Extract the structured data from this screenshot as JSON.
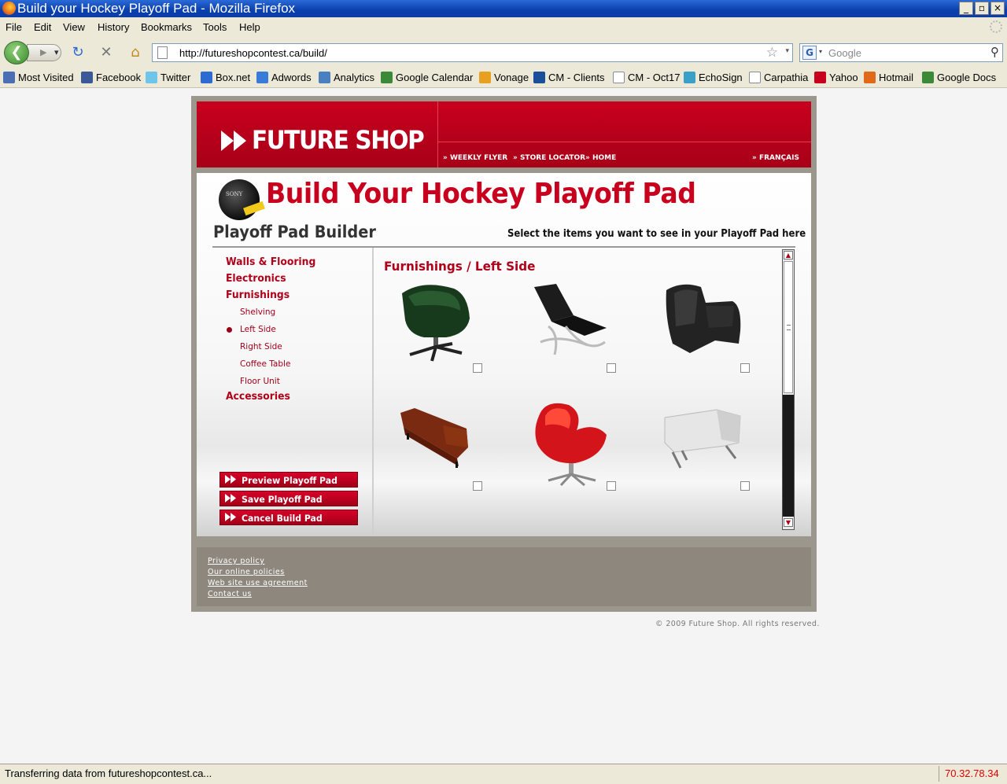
{
  "window": {
    "title": "Build your Hockey Playoff Pad - Mozilla Firefox",
    "controls": {
      "minimize": "_",
      "maximize": "▫",
      "close": "×"
    }
  },
  "menu": [
    "File",
    "Edit",
    "View",
    "History",
    "Bookmarks",
    "Tools",
    "Help"
  ],
  "navigation": {
    "url": "http://futureshopcontest.ca/build/",
    "search_placeholder": "Google",
    "search_engine_icon": "google-icon"
  },
  "bookmarks": [
    {
      "label": "Most Visited",
      "icon": "most-visited-icon",
      "color": "#4a6fb5"
    },
    {
      "label": "Facebook",
      "icon": "facebook-icon",
      "color": "#3b5998"
    },
    {
      "label": "Twitter",
      "icon": "twitter-icon",
      "color": "#6fc4ea"
    },
    {
      "label": "Box.net",
      "icon": "box-icon",
      "color": "#2d6bd2"
    },
    {
      "label": "Adwords",
      "icon": "google-icon",
      "color": "#3a7ad8"
    },
    {
      "label": "Analytics",
      "icon": "analytics-icon",
      "color": "#4a7fc0"
    },
    {
      "label": "Google Calendar",
      "icon": "google-icon",
      "color": "#3a8a3a"
    },
    {
      "label": "Vonage",
      "icon": "vonage-icon",
      "color": "#e8a020"
    },
    {
      "label": "CM - Clients",
      "icon": "cm-icon",
      "color": "#1a4f9a"
    },
    {
      "label": "CM - Oct17",
      "icon": "page-icon",
      "color": "#ffffff"
    },
    {
      "label": "EchoSign",
      "icon": "echosign-icon",
      "color": "#3aa0c8"
    },
    {
      "label": "Carpathia",
      "icon": "page-icon",
      "color": "#ffffff"
    },
    {
      "label": "Yahoo",
      "icon": "yahoo-icon",
      "color": "#c8001e"
    },
    {
      "label": "Hotmail",
      "icon": "windows-icon",
      "color": "#e06a1a"
    },
    {
      "label": "Google Docs",
      "icon": "google-icon",
      "color": "#3a8a3a"
    }
  ],
  "site": {
    "logo": "FUTURE SHOP",
    "header_nav": [
      "WEEKLY FLYER",
      "STORE LOCATOR",
      "HOME"
    ],
    "language_link": "FRANÇAIS",
    "puck_brand": "SONY",
    "page_title": "Build Your Hockey Playoff Pad",
    "builder_title": "Playoff Pad Builder",
    "builder_hint": "Select the items you want to see in your Playoff Pad here",
    "categories": [
      {
        "label": "Walls & Flooring"
      },
      {
        "label": "Electronics"
      },
      {
        "label": "Furnishings"
      }
    ],
    "subcategories": [
      {
        "label": "Shelving",
        "selected": false
      },
      {
        "label": "Left Side",
        "selected": true
      },
      {
        "label": "Right Side",
        "selected": false
      },
      {
        "label": "Coffee Table",
        "selected": false
      },
      {
        "label": "Floor Unit",
        "selected": false
      }
    ],
    "last_category": "Accessories",
    "panel_title": "Furnishings / Left Side",
    "items": [
      {
        "name": "dark-green-swivel-chair",
        "checked": false
      },
      {
        "name": "black-barcelona-chair",
        "checked": false
      },
      {
        "name": "black-leather-club-chair",
        "checked": false
      },
      {
        "name": "brown-leather-sofa",
        "checked": false
      },
      {
        "name": "red-egg-chair",
        "checked": false
      },
      {
        "name": "white-modern-armchair",
        "checked": false
      }
    ],
    "actions": [
      "Preview Playoff Pad",
      "Save Playoff Pad",
      "Cancel Build Pad"
    ],
    "footer_links": [
      "Privacy policy",
      "Our online policies",
      "Web site use agreement",
      "Contact us"
    ],
    "copyright": "© 2009 Future Shop. All rights reserved."
  },
  "status": {
    "message": "Transferring data from futureshopcontest.ca...",
    "ip": "70.32.78.34"
  },
  "colors": {
    "brand_red": "#c8001e",
    "footer_gray": "#8d877d"
  }
}
